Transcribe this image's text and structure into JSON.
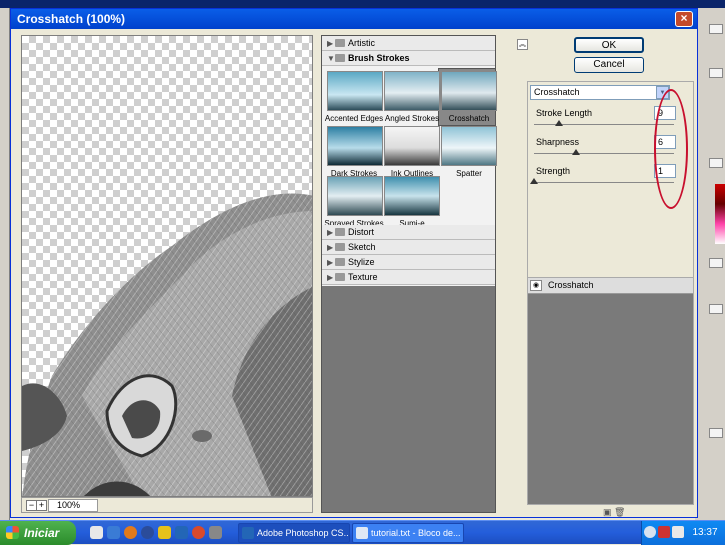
{
  "dialog": {
    "title": "Crosshatch (100%)",
    "close_glyph": "×",
    "zoom_minus": "−",
    "zoom_plus": "+",
    "zoom": "100%"
  },
  "filter_list": {
    "categories_top": [
      "Artistic",
      "Brush Strokes"
    ],
    "brush_strokes": [
      {
        "label": "Accented Edges"
      },
      {
        "label": "Angled Strokes"
      },
      {
        "label": "Crosshatch",
        "selected": true
      },
      {
        "label": "Dark Strokes"
      },
      {
        "label": "Ink Outlines"
      },
      {
        "label": "Spatter"
      },
      {
        "label": "Sprayed Strokes"
      },
      {
        "label": "Sumi-e"
      }
    ],
    "categories_bottom": [
      "Distort",
      "Sketch",
      "Stylize",
      "Texture"
    ]
  },
  "buttons": {
    "ok": "OK",
    "cancel": "Cancel"
  },
  "settings": {
    "filter_selected": "Crosshatch",
    "params": [
      {
        "label": "Stroke Length",
        "value": "9",
        "level": 0.18
      },
      {
        "label": "Sharpness",
        "value": "6",
        "level": 0.3
      },
      {
        "label": "Strength",
        "value": "1",
        "level": 0.0
      }
    ]
  },
  "layers": {
    "items": [
      "Crosshatch"
    ]
  },
  "taskbar": {
    "start_label": "Iniciar",
    "tasks": [
      "Adobe Photoshop CS...",
      "tutorial.txt - Bloco de..."
    ],
    "clock": "13:37"
  },
  "colors": {
    "accent_red": "#c8102e",
    "titlebar": "#0a5ee8",
    "taskbar": "#245edb"
  }
}
